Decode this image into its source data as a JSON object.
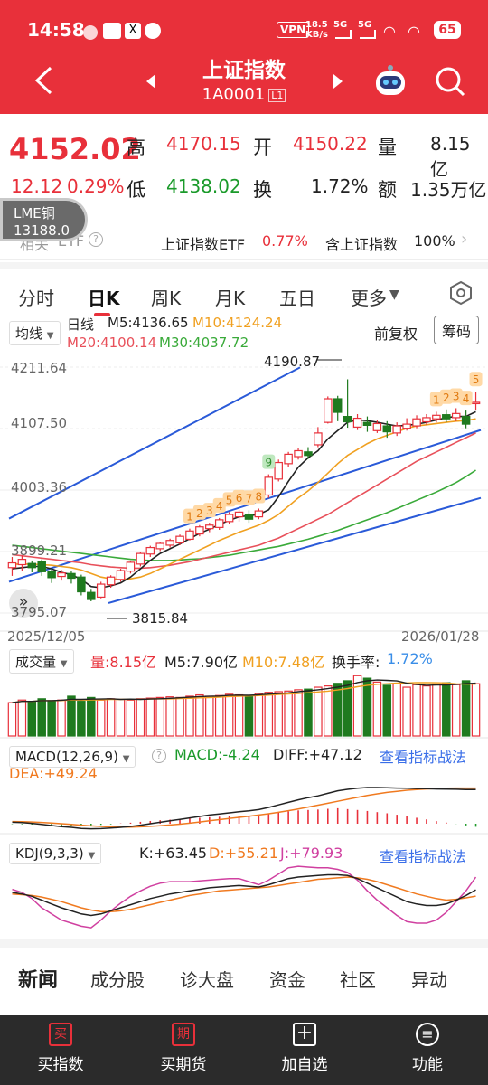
{
  "status": {
    "time": "14:58",
    "vpn": "VPN",
    "speed": "18.5\nKB/s",
    "sig1": "5G",
    "sig2": "5G",
    "battery": "65"
  },
  "nav": {
    "title": "上证指数",
    "code": "1A0001",
    "level": "L1"
  },
  "quote": {
    "price": "4152.02",
    "change": "12.12",
    "pct": "0.29%",
    "high_label": "高",
    "high": "4170.15",
    "open_label": "开",
    "open": "4150.22",
    "vol_label": "量",
    "vol": "8.15亿",
    "low_label": "低",
    "low": "4138.02",
    "turn_label": "换",
    "turn": "1.72%",
    "amt_label": "额",
    "amt": "1.35万亿"
  },
  "lme": {
    "name": "LME铜",
    "value": "13188.0"
  },
  "etf": {
    "related": "相关",
    "etf_label": "ETF",
    "name": "上证指数ETF",
    "pct": "0.77%",
    "contain": "含上证指数",
    "contain_pct": "100%"
  },
  "tabs": [
    "分时",
    "日K",
    "周K",
    "月K",
    "五日",
    "更多"
  ],
  "chart": {
    "ma_btn": "均线",
    "period": "日线",
    "m5": "M5:4136.65",
    "m10": "M10:4124.24",
    "m20": "M20:4100.14",
    "m30": "M30:4037.72",
    "adj": "前复权",
    "chip": "筹码",
    "y_labels": [
      "4211.64",
      "4107.50",
      "4003.36",
      "3899.21",
      "3795.07"
    ],
    "hi_mark": "4190.87",
    "lo_mark": "3815.84",
    "date_start": "2025/12/05",
    "date_end": "2026/01/28",
    "vol_btn": "成交量",
    "vol_val": "量:8.15亿",
    "vol_m5": "M5:7.90亿",
    "vol_m10": "M10:7.48亿",
    "turn_txt": "换手率:",
    "turn_val": "1.72%",
    "macd_btn": "MACD(12,26,9)",
    "macd": "MACD:-4.24",
    "diff": "DIFF:+47.12",
    "dea": "DEA:+49.24",
    "view1": "查看指标战法",
    "kdj_btn": "KDJ(9,3,3)",
    "k": "K:+63.45",
    "d": "D:+55.21",
    "j": "J:+79.93",
    "view2": "查看指标战法"
  },
  "chart_data": {
    "type": "candlestick",
    "x": [
      "2025/12/05",
      "2026/01/28"
    ],
    "ylim": [
      3795.07,
      4211.64
    ],
    "candles": [
      [
        3872,
        3880,
        3858,
        3890
      ],
      [
        3877,
        3886,
        3866,
        3892
      ],
      [
        3879,
        3872,
        3864,
        3884
      ],
      [
        3882,
        3865,
        3858,
        3886
      ],
      [
        3866,
        3855,
        3846,
        3870
      ],
      [
        3857,
        3863,
        3850,
        3868
      ],
      [
        3862,
        3854,
        3845,
        3866
      ],
      [
        3856,
        3831,
        3825,
        3860
      ],
      [
        3830,
        3818,
        3815,
        3836
      ],
      [
        3822,
        3844,
        3820,
        3848
      ],
      [
        3843,
        3856,
        3838,
        3859
      ],
      [
        3852,
        3867,
        3848,
        3870
      ],
      [
        3866,
        3881,
        3862,
        3884
      ],
      [
        3878,
        3896,
        3874,
        3899
      ],
      [
        3895,
        3906,
        3890,
        3909
      ],
      [
        3904,
        3913,
        3900,
        3916
      ],
      [
        3910,
        3918,
        3906,
        3921
      ],
      [
        3914,
        3925,
        3910,
        3928
      ],
      [
        3920,
        3934,
        3918,
        3938
      ],
      [
        3929,
        3941,
        3925,
        3944
      ],
      [
        3938,
        3944,
        3932,
        3948
      ],
      [
        3940,
        3953,
        3936,
        3956
      ],
      [
        3950,
        3962,
        3946,
        3966
      ],
      [
        3958,
        3966,
        3950,
        3970
      ],
      [
        3962,
        3954,
        3948,
        3969
      ],
      [
        3958,
        3968,
        3954,
        3972
      ],
      [
        3995,
        4025,
        3990,
        4030
      ],
      [
        4022,
        4050,
        4018,
        4055
      ],
      [
        4048,
        4064,
        4042,
        4068
      ],
      [
        4060,
        4070,
        4055,
        4074
      ],
      [
        4068,
        4062,
        4056,
        4076
      ],
      [
        4080,
        4100,
        4076,
        4110
      ],
      [
        4118,
        4158,
        4116,
        4162
      ],
      [
        4158,
        4135,
        4120,
        4163
      ],
      [
        4128,
        4119,
        4109,
        4191
      ],
      [
        4110,
        4125,
        4105,
        4132
      ],
      [
        4118,
        4113,
        4102,
        4128
      ],
      [
        4104,
        4116,
        4100,
        4122
      ],
      [
        4112,
        4102,
        4092,
        4120
      ],
      [
        4100,
        4112,
        4095,
        4118
      ],
      [
        4108,
        4115,
        4104,
        4125
      ],
      [
        4112,
        4124,
        4108,
        4130
      ],
      [
        4119,
        4126,
        4114,
        4132
      ],
      [
        4124,
        4130,
        4118,
        4136
      ],
      [
        4131,
        4124,
        4118,
        4140
      ],
      [
        4126,
        4133,
        4120,
        4142
      ],
      [
        4128,
        4115,
        4108,
        4138
      ],
      [
        4150,
        4152,
        4138,
        4170
      ]
    ],
    "ma5": [
      3870,
      3872,
      3874,
      3874,
      3870,
      3864,
      3860,
      3852,
      3840,
      3838,
      3841,
      3846,
      3856,
      3870,
      3884,
      3896,
      3904,
      3912,
      3921,
      3930,
      3937,
      3945,
      3952,
      3958,
      3960,
      3962,
      3970,
      3992,
      4018,
      4042,
      4058,
      4070,
      4090,
      4104,
      4118,
      4122,
      4121,
      4118,
      4115,
      4112,
      4113,
      4115,
      4118,
      4122,
      4126,
      4128,
      4128,
      4136
    ],
    "ma10": [
      3878,
      3878,
      3878,
      3877,
      3876,
      3874,
      3872,
      3868,
      3862,
      3856,
      3853,
      3852,
      3853,
      3856,
      3862,
      3870,
      3878,
      3886,
      3894,
      3902,
      3910,
      3918,
      3925,
      3932,
      3938,
      3944,
      3952,
      3962,
      3976,
      3990,
      4002,
      4016,
      4032,
      4048,
      4062,
      4072,
      4082,
      4090,
      4096,
      4102,
      4108,
      4112,
      4114,
      4116,
      4118,
      4120,
      4121,
      4124
    ],
    "ma20": [
      3894,
      3892,
      3890,
      3888,
      3886,
      3884,
      3882,
      3880,
      3877,
      3875,
      3873,
      3872,
      3871,
      3871,
      3872,
      3874,
      3876,
      3879,
      3882,
      3886,
      3890,
      3894,
      3898,
      3902,
      3906,
      3910,
      3916,
      3922,
      3930,
      3938,
      3946,
      3954,
      3962,
      3972,
      3982,
      3992,
      4002,
      4012,
      4022,
      4032,
      4042,
      4052,
      4060,
      4068,
      4076,
      4084,
      4092,
      4100
    ],
    "ma30": [
      3910,
      3908,
      3906,
      3904,
      3902,
      3900,
      3898,
      3896,
      3894,
      3892,
      3890,
      3888,
      3886,
      3885,
      3884,
      3884,
      3884,
      3885,
      3886,
      3887,
      3889,
      3891,
      3893,
      3896,
      3899,
      3902,
      3905,
      3908,
      3912,
      3916,
      3920,
      3925,
      3930,
      3935,
      3941,
      3947,
      3953,
      3959,
      3965,
      3972,
      3979,
      3986,
      3993,
      4000,
      4008,
      4016,
      4026,
      4037
    ],
    "volume": [
      5.2,
      5.6,
      5.4,
      5.8,
      5.5,
      5.6,
      6.2,
      5.4,
      6.0,
      5.6,
      5.8,
      5.7,
      5.6,
      5.8,
      5.9,
      6.0,
      6.1,
      6.0,
      6.2,
      6.4,
      6.2,
      6.3,
      6.5,
      6.4,
      6.3,
      6.6,
      6.8,
      6.9,
      7.0,
      7.2,
      7.3,
      7.6,
      7.8,
      8.2,
      8.6,
      9.4,
      9.0,
      8.4,
      7.9,
      8.2,
      7.6,
      8.0,
      7.8,
      8.1,
      8.3,
      8.0,
      8.6,
      8.15
    ],
    "macd_bars": [
      -0.5,
      -0.8,
      -1.2,
      -1.8,
      -2.4,
      -2.9,
      -3.4,
      -3.8,
      -2.2,
      -1.6,
      -0.8,
      0.4,
      1.4,
      2.6,
      3.8,
      4.8,
      5.6,
      6.4,
      7.4,
      8.2,
      9.0,
      9.6,
      10.2,
      10.6,
      10.4,
      11.2,
      13.2,
      15.6,
      17.0,
      18.4,
      19.0,
      19.6,
      20.6,
      21.4,
      20.2,
      19.0,
      17.6,
      16.0,
      14.4,
      12.4,
      10.6,
      8.2,
      6.0,
      3.6,
      1.6,
      -0.2,
      -2.4,
      -4.24
    ],
    "macd_diff": [
      2.0,
      1.5,
      0.5,
      -1.0,
      -2.5,
      -4.0,
      -5.0,
      -6.5,
      -7.0,
      -6.8,
      -6.0,
      -5.0,
      -3.8,
      -2.0,
      0.0,
      2.0,
      4.0,
      6.0,
      8.0,
      10.0,
      12.0,
      13.5,
      15.0,
      16.5,
      17.8,
      19.5,
      22.5,
      26.0,
      29.5,
      33.0,
      36.0,
      38.5,
      42.0,
      45.5,
      47.5,
      49.0,
      50.0,
      50.0,
      49.6,
      49.2,
      49.0,
      48.6,
      48.4,
      48.0,
      47.8,
      47.6,
      47.2,
      47.12
    ],
    "macd_dea": [
      3.0,
      2.8,
      2.4,
      1.8,
      1.0,
      0.0,
      -1.0,
      -2.0,
      -3.0,
      -3.8,
      -4.4,
      -4.6,
      -4.6,
      -4.2,
      -3.6,
      -2.8,
      -1.8,
      -0.6,
      0.8,
      2.4,
      4.0,
      5.6,
      7.2,
      8.8,
      10.4,
      12.0,
      13.8,
      15.8,
      18.0,
      20.4,
      23.0,
      25.6,
      28.2,
      31.0,
      33.8,
      36.4,
      39.0,
      41.2,
      43.2,
      44.8,
      46.2,
      47.2,
      48.0,
      48.6,
      49.0,
      49.2,
      49.2,
      49.24
    ],
    "kdj_k": [
      60,
      58,
      55,
      50,
      45,
      40,
      36,
      32,
      30,
      32,
      36,
      40,
      44,
      48,
      52,
      55,
      58,
      60,
      62,
      64,
      66,
      67,
      68,
      69,
      68,
      67,
      70,
      74,
      78,
      80,
      81,
      82,
      83,
      83,
      82,
      78,
      72,
      66,
      60,
      54,
      48,
      45,
      43,
      43,
      45,
      50,
      56,
      63.45
    ],
    "kdj_d": [
      58,
      57,
      56,
      54,
      51,
      48,
      44,
      40,
      37,
      35,
      35,
      36,
      38,
      41,
      44,
      47,
      50,
      53,
      56,
      58,
      60,
      62,
      63,
      64,
      65,
      66,
      67,
      69,
      71,
      73,
      75,
      77,
      78,
      79,
      80,
      79,
      77,
      74,
      70,
      66,
      62,
      58,
      55,
      52,
      50,
      51,
      53,
      55.21
    ],
    "kdj_j": [
      64,
      60,
      52,
      40,
      32,
      24,
      20,
      16,
      14,
      24,
      36,
      46,
      55,
      62,
      68,
      72,
      74,
      74,
      74,
      75,
      76,
      77,
      78,
      78,
      74,
      70,
      76,
      84,
      92,
      94,
      93,
      92,
      92,
      90,
      86,
      76,
      62,
      50,
      40,
      30,
      22,
      20,
      20,
      24,
      34,
      48,
      62,
      79.93
    ],
    "markers": [
      {
        "i": 18,
        "n": "1"
      },
      {
        "i": 19,
        "n": "2"
      },
      {
        "i": 20,
        "n": "3"
      },
      {
        "i": 21,
        "n": "4"
      },
      {
        "i": 22,
        "n": "5"
      },
      {
        "i": 23,
        "n": "6"
      },
      {
        "i": 24,
        "n": "7"
      },
      {
        "i": 25,
        "n": "8"
      },
      {
        "i": 26,
        "n": "9"
      },
      {
        "i": 43,
        "n": "1"
      },
      {
        "i": 44,
        "n": "2"
      },
      {
        "i": 45,
        "n": "3"
      },
      {
        "i": 46,
        "n": "4"
      },
      {
        "i": 47,
        "n": "5"
      }
    ]
  },
  "news_tabs": [
    "新闻",
    "成分股",
    "诊大盘",
    "资金",
    "社区",
    "异动"
  ],
  "bottom": {
    "b1": "买指数",
    "b1i": "买",
    "b2": "买期货",
    "b2i": "期",
    "b3": "加自选",
    "b3i": "+",
    "b4": "功能",
    "b4i": "≡"
  }
}
